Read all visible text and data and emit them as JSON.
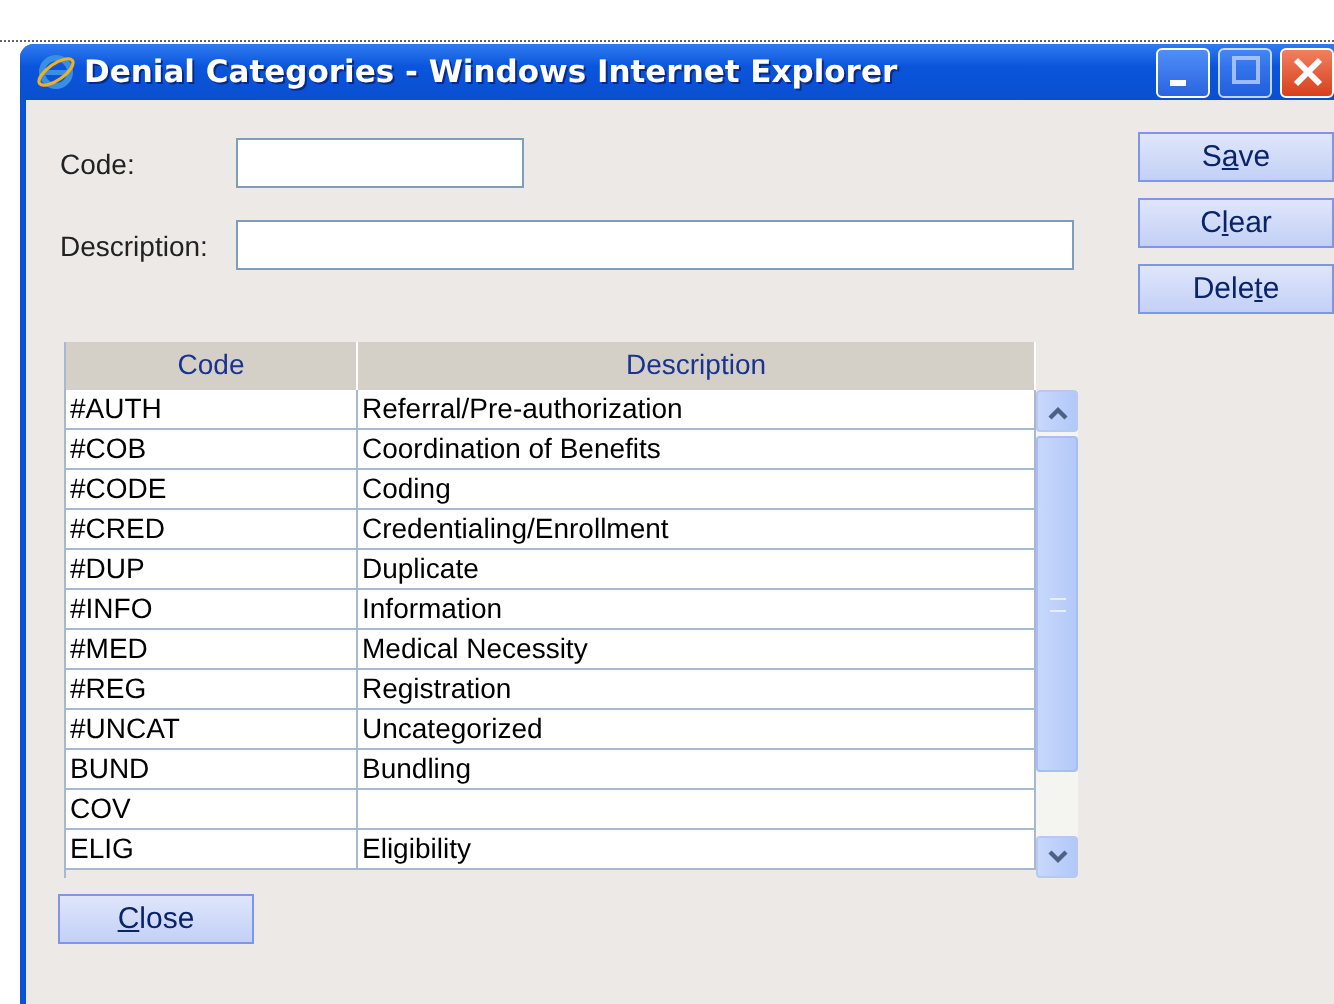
{
  "window": {
    "title": "Denial Categories - Windows Internet Explorer"
  },
  "fields": [
    {
      "label": "Code:"
    },
    {
      "label": "Description:"
    }
  ],
  "side_buttons": [
    {
      "label": {
        "before": "S",
        "key": "a",
        "after": "ve"
      }
    },
    {
      "label": {
        "before": "C",
        "key": "l",
        "after": "ear"
      }
    },
    {
      "label": {
        "before": "Dele",
        "key": "t",
        "after": "e"
      }
    }
  ],
  "table": {
    "columns": [
      "Code",
      "Description"
    ],
    "rows": [
      {
        "code": "#AUTH",
        "description": "Referral/Pre-authorization"
      },
      {
        "code": "#COB",
        "description": "Coordination of Benefits"
      },
      {
        "code": "#CODE",
        "description": "Coding"
      },
      {
        "code": "#CRED",
        "description": "Credentialing/Enrollment"
      },
      {
        "code": "#DUP",
        "description": "Duplicate"
      },
      {
        "code": "#INFO",
        "description": "Information"
      },
      {
        "code": "#MED",
        "description": "Medical Necessity"
      },
      {
        "code": "#REG",
        "description": "Registration"
      },
      {
        "code": "#UNCAT",
        "description": "Uncategorized"
      },
      {
        "code": "BUND",
        "description": "Bundling"
      },
      {
        "code": "COV"
      },
      {
        "code": "ELIG",
        "description": "Eligibility"
      }
    ]
  },
  "close_button": {
    "label": {
      "key": "C",
      "after": "lose"
    }
  }
}
